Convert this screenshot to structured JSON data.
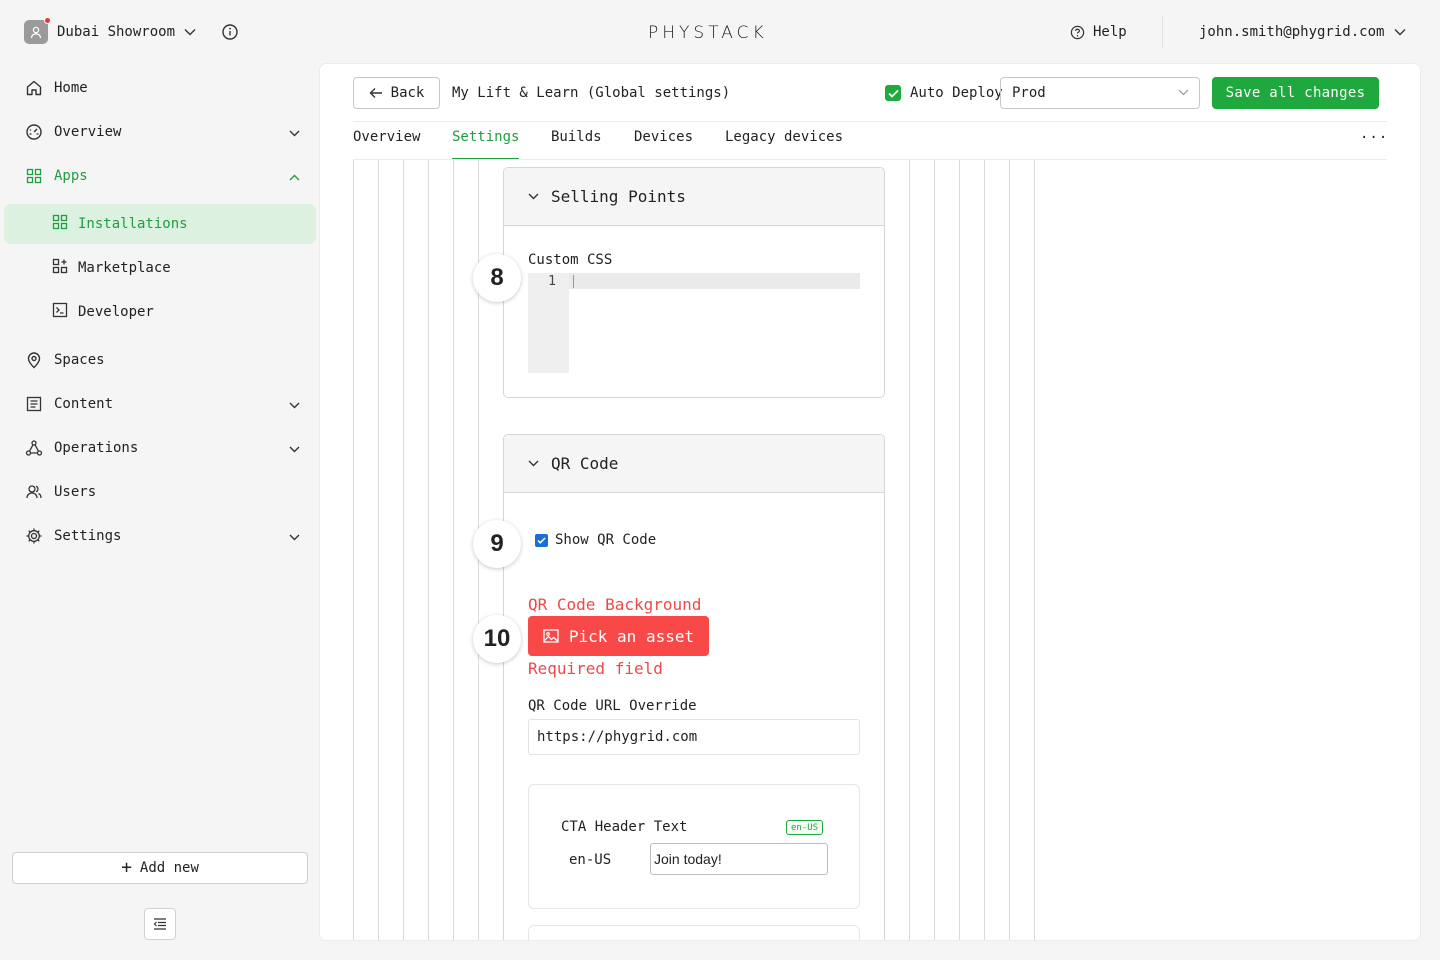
{
  "org": {
    "name": "Dubai Showroom"
  },
  "brand": {
    "logo_text": "PHYSTACK"
  },
  "header": {
    "help_label": "Help",
    "user_email": "john.smith@phygrid.com"
  },
  "sidebar": {
    "items": [
      {
        "label": "Home"
      },
      {
        "label": "Overview"
      },
      {
        "label": "Apps"
      },
      {
        "label": "Installations"
      },
      {
        "label": "Marketplace"
      },
      {
        "label": "Developer"
      },
      {
        "label": "Spaces"
      },
      {
        "label": "Content"
      },
      {
        "label": "Operations"
      },
      {
        "label": "Users"
      },
      {
        "label": "Settings"
      }
    ],
    "add_new_label": "Add new"
  },
  "toolbar": {
    "back_label": "Back",
    "title": "My Lift & Learn (Global settings)",
    "auto_deploy_label": "Auto Deploy",
    "auto_deploy_checked": true,
    "environment": "Prod",
    "save_label": "Save all changes"
  },
  "tabs": [
    {
      "label": "Overview"
    },
    {
      "label": "Settings",
      "active": true
    },
    {
      "label": "Builds"
    },
    {
      "label": "Devices"
    },
    {
      "label": "Legacy devices"
    }
  ],
  "tabs_more": "...",
  "selling_points": {
    "title": "Selling Points",
    "step": "8",
    "custom_css_label": "Custom CSS",
    "line_number": "1"
  },
  "qr_code": {
    "title": "QR Code",
    "step_show": "9",
    "show_label": "Show QR Code",
    "show_checked": true,
    "step_background": "10",
    "background_label": "QR Code Background",
    "pick_asset_label": "Pick an asset",
    "required_msg": "Required field",
    "url_override_label": "QR Code URL Override",
    "url_override_value": "https://phygrid.com",
    "cta": {
      "header_label": "CTA Header Text",
      "locale_badge": "en-US",
      "locale_label": "en-US",
      "value": "Join today!"
    }
  },
  "colors": {
    "accent": "#1f9d3f",
    "selected_bg": "#dcf1e0",
    "error": "#f04848",
    "checkbox_blue": "#1a6fd6"
  }
}
